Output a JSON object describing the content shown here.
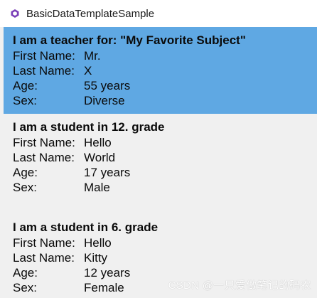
{
  "window": {
    "title": "BasicDataTemplateSample",
    "accent": "#5fa8e3"
  },
  "labels": {
    "first_name": "First Name:",
    "last_name": "Last Name:",
    "age": "Age:",
    "sex": "Sex:"
  },
  "items": [
    {
      "heading": "I am a teacher for: \"My Favorite Subject\"",
      "first_name": "Mr.",
      "last_name": "X",
      "age": "55 years",
      "sex": "Diverse",
      "selected": true
    },
    {
      "heading": "I am a student in 12. grade",
      "first_name": "Hello",
      "last_name": "World",
      "age": "17 years",
      "sex": "Male",
      "selected": false
    },
    {
      "heading": "I am a student in 6. grade",
      "first_name": "Hello",
      "last_name": "Kitty",
      "age": "12 years",
      "sex": "Female",
      "selected": false
    }
  ],
  "watermark": "CSDN @一只爱做笔记的码农"
}
